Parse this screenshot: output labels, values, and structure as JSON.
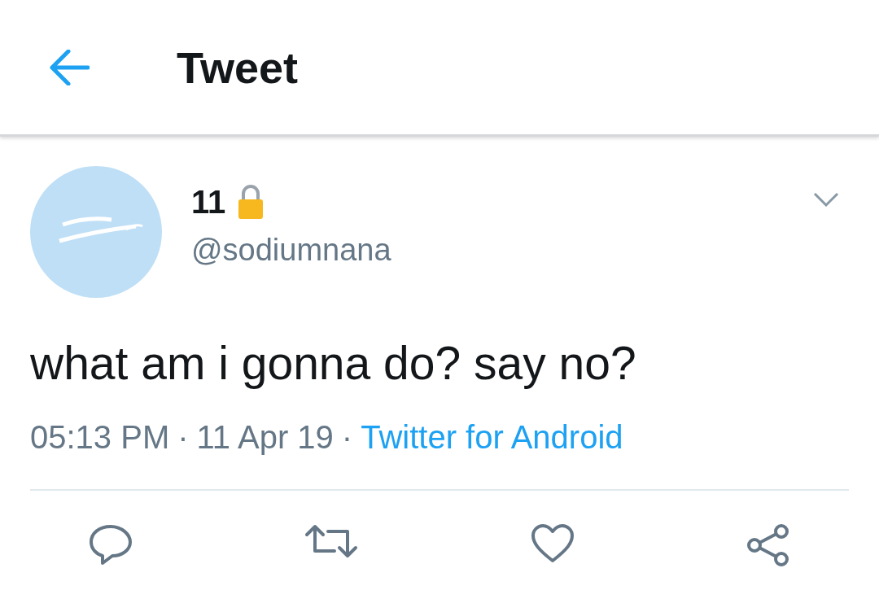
{
  "header": {
    "title": "Tweet"
  },
  "tweet": {
    "name": "11",
    "handle": "@sodiumnana",
    "text": "what am i gonna do? say no?",
    "meta": [
      {
        "kind": "text",
        "text": "05:13 PM"
      },
      {
        "kind": "separator",
        "text": "·"
      },
      {
        "kind": "text",
        "text": "11 Apr 19"
      },
      {
        "kind": "separator",
        "text": "·"
      },
      {
        "kind": "link",
        "text": "Twitter for Android"
      }
    ]
  }
}
